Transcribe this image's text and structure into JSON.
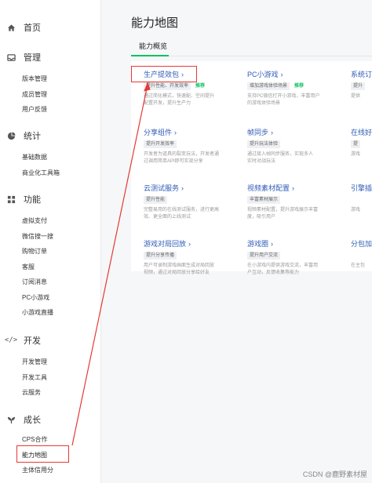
{
  "sidebar": {
    "home": "首页",
    "manage": {
      "title": "管理",
      "items": [
        "版本管理",
        "成员管理",
        "用户反馈"
      ]
    },
    "stats": {
      "title": "统计",
      "items": [
        "基础数据",
        "商业化工具箱"
      ]
    },
    "features": {
      "title": "功能",
      "items": [
        "虚拟支付",
        "微信搜一搜",
        "购物订单",
        "客服",
        "订阅消息",
        "PC小游戏",
        "小游戏直播"
      ]
    },
    "dev": {
      "title": "开发",
      "items": [
        "开发管理",
        "开发工具",
        "云服务"
      ]
    },
    "growth": {
      "title": "成长",
      "items": [
        "CPS合作",
        "能力地图",
        "主体信用分"
      ]
    }
  },
  "main": {
    "title": "能力地图",
    "tab": "能力概览",
    "cards": [
      {
        "title": "生产提效包",
        "tags": [
          "提升性能、开发效率"
        ],
        "badge": "推荐",
        "desc": [
          "通过简化模式，快速配、空间提升",
          "配置开发，提升生产力"
        ]
      },
      {
        "title": "PC小游戏",
        "tags": [
          "增加游戏体验场景"
        ],
        "badge": "推荐",
        "desc": [
          "支持PC微信打开小游戏，丰富用户",
          "的游戏体验场景"
        ]
      },
      {
        "title": "系统订",
        "tags": [
          "提升"
        ],
        "badge": "",
        "desc": [
          "提供"
        ]
      },
      {
        "title": "分享组件",
        "tags": [
          "提升开发效率"
        ],
        "badge": "",
        "desc": [
          "开发者为道具的裂变玩法，开发者通",
          "过调用简单API即可实现分享"
        ]
      },
      {
        "title": "帧同步",
        "tags": [
          "提升玩法体验"
        ],
        "badge": "",
        "desc": [
          "通过接入帧同步服务，实现多人",
          "实时对战玩法"
        ]
      },
      {
        "title": "在线好",
        "tags": [
          "提"
        ],
        "badge": "",
        "desc": [
          "游戏"
        ]
      },
      {
        "title": "云测试服务",
        "tags": [
          "提升性能"
        ],
        "badge": "",
        "desc": [
          "完整易用的在线测试服务，进行更高",
          "效、更全面的上线测试"
        ]
      },
      {
        "title": "视频素材配置",
        "tags": [
          "丰富素材展示"
        ],
        "badge": "",
        "desc": [
          "视频素材配置，提升游戏展示丰富",
          "度，吸引用户"
        ]
      },
      {
        "title": "引擎插",
        "tags": [],
        "badge": "",
        "desc": [
          "游戏"
        ]
      },
      {
        "title": "游戏对局回放",
        "tags": [
          "提升分享传播"
        ],
        "badge": "",
        "desc": [
          "用户可录制游戏画面生成对局回放",
          "视频，通过对局回放分享给好友"
        ]
      },
      {
        "title": "游戏圈",
        "tags": [
          "提升用户交流"
        ],
        "badge": "",
        "desc": [
          "在小游戏内提供游戏交流，丰富用",
          "户互动，反馈收集等能力"
        ]
      },
      {
        "title": "分包加",
        "tags": [],
        "badge": "",
        "desc": [
          "在主包"
        ]
      }
    ]
  },
  "footer": {
    "watermark": "CSDN @鹿野素材屋"
  },
  "colors": {
    "accent": "#07c160",
    "link": "#2f5bb8",
    "annotation": "#e53935"
  }
}
